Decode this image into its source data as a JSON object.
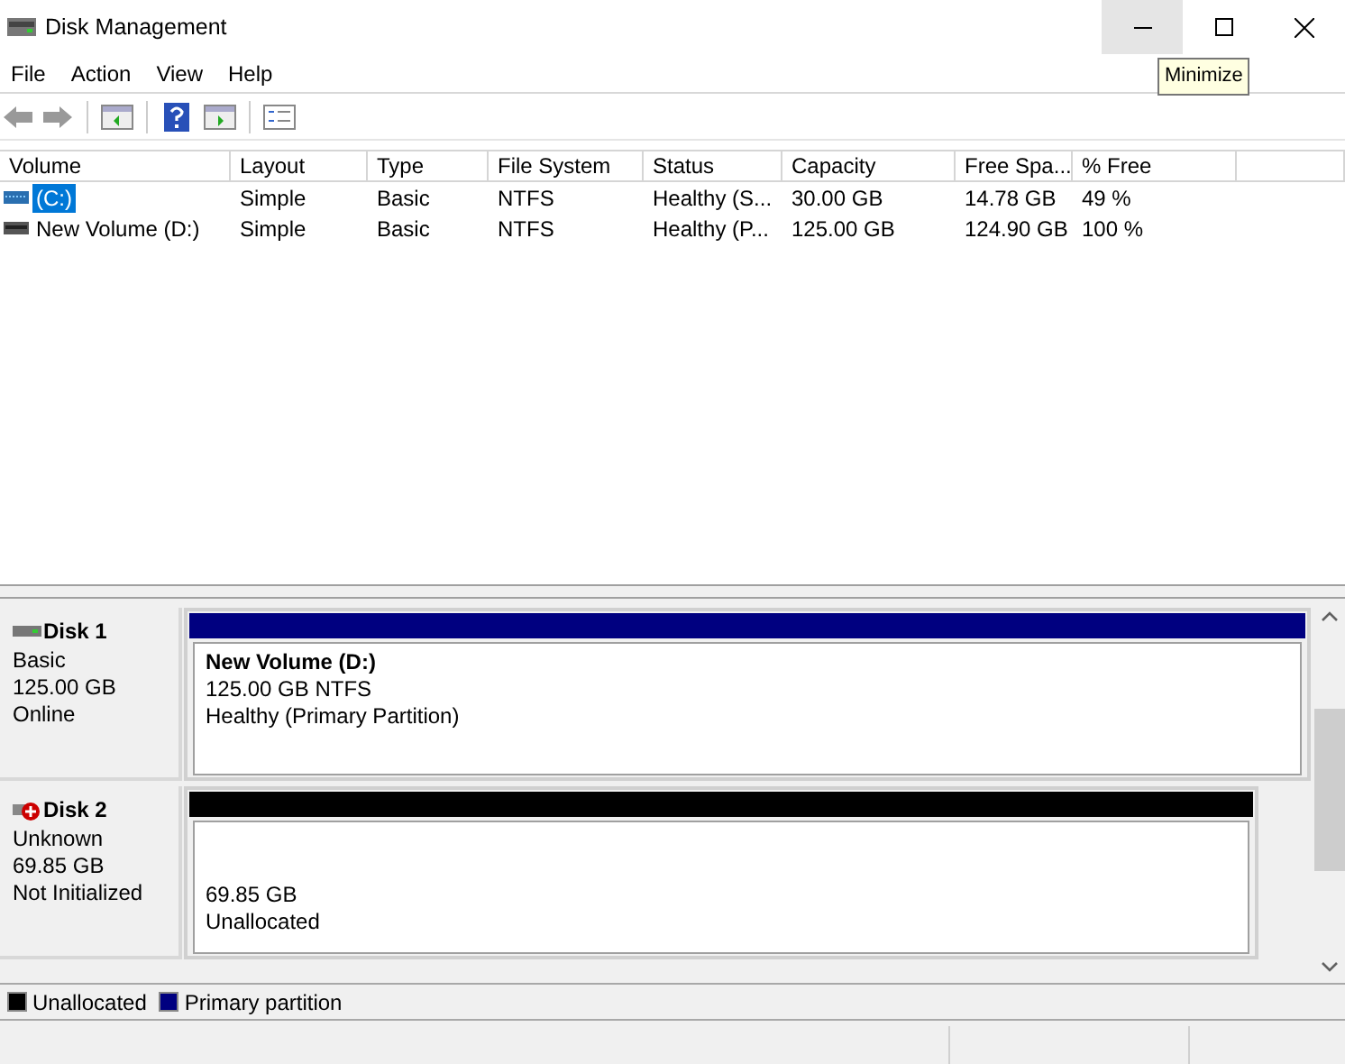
{
  "window": {
    "title": "Disk Management",
    "tooltip": "Minimize",
    "minimize_hovered": true
  },
  "menu": [
    "File",
    "Action",
    "View",
    "Help"
  ],
  "table": {
    "columns": [
      "Volume",
      "Layout",
      "Type",
      "File System",
      "Status",
      "Capacity",
      "Free Spa...",
      "% Free"
    ],
    "rows": [
      {
        "selected": true,
        "kind": "system",
        "cells": [
          "(C:)",
          "Simple",
          "Basic",
          "NTFS",
          "Healthy (S...",
          "30.00 GB",
          "14.78 GB",
          "49 %"
        ]
      },
      {
        "selected": false,
        "kind": "disk",
        "cells": [
          "New Volume (D:)",
          "Simple",
          "Basic",
          "NTFS",
          "Healthy (P...",
          "125.00 GB",
          "124.90 GB",
          "100 %"
        ]
      }
    ]
  },
  "disks": [
    {
      "name": "Disk 1",
      "error": false,
      "details": [
        "Basic",
        "125.00 GB",
        "Online"
      ],
      "partition": {
        "color": "#000080",
        "title": "New Volume  (D:)",
        "lines": [
          "125.00 GB NTFS",
          "Healthy (Primary Partition)"
        ]
      }
    },
    {
      "name": "Disk 2",
      "error": true,
      "details": [
        "Unknown",
        "69.85 GB",
        "Not Initialized"
      ],
      "partition": {
        "color": "#000000",
        "lines": [
          "69.85 GB",
          "Unallocated"
        ]
      }
    }
  ],
  "legend": [
    {
      "label": "Unallocated",
      "color": "#000000"
    },
    {
      "label": "Primary partition",
      "color": "#000080"
    }
  ]
}
